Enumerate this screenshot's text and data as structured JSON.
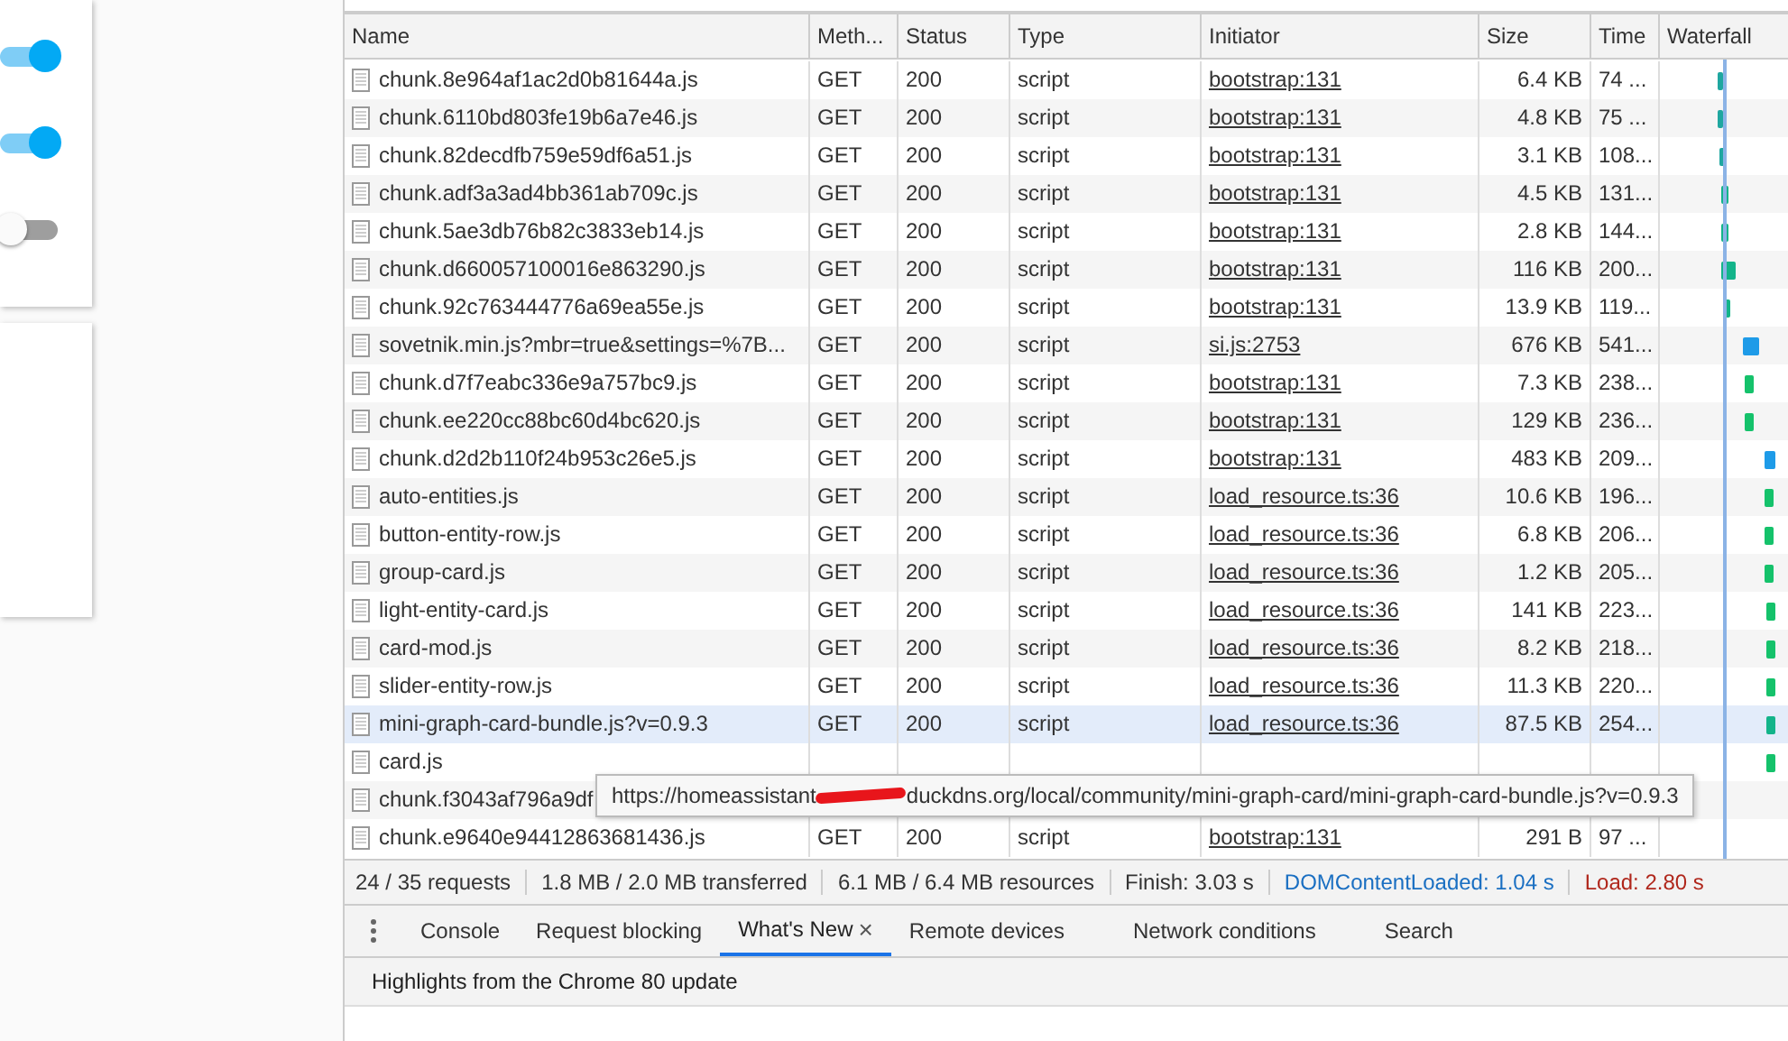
{
  "page": {
    "toggles": [
      {
        "on": true
      },
      {
        "on": true
      },
      {
        "on": false
      }
    ]
  },
  "network": {
    "columns": [
      "Name",
      "Meth...",
      "Status",
      "Type",
      "Initiator",
      "Size",
      "Time",
      "Waterfall"
    ],
    "rows": [
      {
        "name": "chunk.8e964af1ac2d0b81644a.js",
        "method": "GET",
        "status": "200",
        "type": "script",
        "initiator": "bootstrap:131",
        "size": "6.4 KB",
        "time": "74 ...",
        "color": "#1fa7a0",
        "highlighted": false
      },
      {
        "name": "chunk.6110bd803fe19b6a7e46.js",
        "method": "GET",
        "status": "200",
        "type": "script",
        "initiator": "bootstrap:131",
        "size": "4.8 KB",
        "time": "75 ...",
        "color": "#1fa7a0",
        "highlighted": false
      },
      {
        "name": "chunk.82decdfb759e59df6a51.js",
        "method": "GET",
        "status": "200",
        "type": "script",
        "initiator": "bootstrap:131",
        "size": "3.1 KB",
        "time": "108...",
        "color": "#1fa7a0",
        "highlighted": false
      },
      {
        "name": "chunk.adf3a3ad4bb361ab709c.js",
        "method": "GET",
        "status": "200",
        "type": "script",
        "initiator": "bootstrap:131",
        "size": "4.5 KB",
        "time": "131...",
        "color": "#13b48a",
        "highlighted": false
      },
      {
        "name": "chunk.5ae3db76b82c3833eb14.js",
        "method": "GET",
        "status": "200",
        "type": "script",
        "initiator": "bootstrap:131",
        "size": "2.8 KB",
        "time": "144...",
        "color": "#13b48a",
        "highlighted": false
      },
      {
        "name": "chunk.d660057100016e863290.js",
        "method": "GET",
        "status": "200",
        "type": "script",
        "initiator": "bootstrap:131",
        "size": "116 KB",
        "time": "200...",
        "color": "#13b48a",
        "highlighted": false
      },
      {
        "name": "chunk.92c763444776a69ea55e.js",
        "method": "GET",
        "status": "200",
        "type": "script",
        "initiator": "bootstrap:131",
        "size": "13.9 KB",
        "time": "119...",
        "color": "#13b48a",
        "highlighted": false
      },
      {
        "name": "sovetnik.min.js?mbr=true&settings=%7B...",
        "method": "GET",
        "status": "200",
        "type": "script",
        "initiator": "si.js:2753",
        "size": "676 KB",
        "time": "541...",
        "color": "#1e9be8",
        "highlighted": false
      },
      {
        "name": "chunk.d7f7eabc336e9a757bc9.js",
        "method": "GET",
        "status": "200",
        "type": "script",
        "initiator": "bootstrap:131",
        "size": "7.3 KB",
        "time": "238...",
        "color": "#15c26b",
        "highlighted": false
      },
      {
        "name": "chunk.ee220cc88bc60d4bc620.js",
        "method": "GET",
        "status": "200",
        "type": "script",
        "initiator": "bootstrap:131",
        "size": "129 KB",
        "time": "236...",
        "color": "#15c26b",
        "highlighted": false
      },
      {
        "name": "chunk.d2d2b110f24b953c26e5.js",
        "method": "GET",
        "status": "200",
        "type": "script",
        "initiator": "bootstrap:131",
        "size": "483 KB",
        "time": "209...",
        "color": "#1e9be8",
        "highlighted": false
      },
      {
        "name": "auto-entities.js",
        "method": "GET",
        "status": "200",
        "type": "script",
        "initiator": "load_resource.ts:36",
        "size": "10.6 KB",
        "time": "196...",
        "color": "#15c26b",
        "highlighted": false
      },
      {
        "name": "button-entity-row.js",
        "method": "GET",
        "status": "200",
        "type": "script",
        "initiator": "load_resource.ts:36",
        "size": "6.8 KB",
        "time": "206...",
        "color": "#15c26b",
        "highlighted": false
      },
      {
        "name": "group-card.js",
        "method": "GET",
        "status": "200",
        "type": "script",
        "initiator": "load_resource.ts:36",
        "size": "1.2 KB",
        "time": "205...",
        "color": "#15c26b",
        "highlighted": false
      },
      {
        "name": "light-entity-card.js",
        "method": "GET",
        "status": "200",
        "type": "script",
        "initiator": "load_resource.ts:36",
        "size": "141 KB",
        "time": "223...",
        "color": "#15c26b",
        "highlighted": false
      },
      {
        "name": "card-mod.js",
        "method": "GET",
        "status": "200",
        "type": "script",
        "initiator": "load_resource.ts:36",
        "size": "8.2 KB",
        "time": "218...",
        "color": "#15c26b",
        "highlighted": false
      },
      {
        "name": "slider-entity-row.js",
        "method": "GET",
        "status": "200",
        "type": "script",
        "initiator": "load_resource.ts:36",
        "size": "11.3 KB",
        "time": "220...",
        "color": "#15c26b",
        "highlighted": false
      },
      {
        "name": "mini-graph-card-bundle.js?v=0.9.3",
        "method": "GET",
        "status": "200",
        "type": "script",
        "initiator": "load_resource.ts:36",
        "size": "87.5 KB",
        "time": "254...",
        "color": "#13b48a",
        "highlighted": true
      },
      {
        "name": "card.js",
        "color": "#15c26b",
        "highlighted": false
      },
      {
        "name": "chunk.f3043af796a9df",
        "highlighted": false
      },
      {
        "name": "chunk.e9640e94412863681436.js",
        "method": "GET",
        "status": "200",
        "type": "script",
        "initiator": "bootstrap:131",
        "size": "291 B",
        "time": "97 ...",
        "highlighted": false
      }
    ],
    "tooltip": {
      "text_before": "https://homeassistant",
      "redacted": true,
      "text_after": "duckdns.org/local/community/mini-graph-card/mini-graph-card-bundle.js?v=0.9.3"
    },
    "summary": [
      {
        "text": "24 / 35 requests",
        "kind": "plain"
      },
      {
        "text": "1.8 MB / 2.0 MB transferred",
        "kind": "plain"
      },
      {
        "text": "6.1 MB / 6.4 MB resources",
        "kind": "plain"
      },
      {
        "text": "Finish: 3.03 s",
        "kind": "plain"
      },
      {
        "text": "DOMContentLoaded: 1.04 s",
        "kind": "dom"
      },
      {
        "text": "Load: 2.80 s",
        "kind": "load"
      }
    ]
  },
  "drawer": {
    "tabs": [
      {
        "label": "Console",
        "selected": false,
        "closable": false
      },
      {
        "label": "Request blocking",
        "selected": false,
        "closable": false
      },
      {
        "label": "What's New",
        "selected": true,
        "closable": true,
        "close": "×"
      },
      {
        "label": "Remote devices",
        "selected": false,
        "closable": false
      },
      {
        "label": "Network conditions",
        "selected": false,
        "closable": false
      },
      {
        "label": "Search",
        "selected": false,
        "closable": false
      }
    ],
    "heading": "Highlights from the Chrome 80 update"
  }
}
